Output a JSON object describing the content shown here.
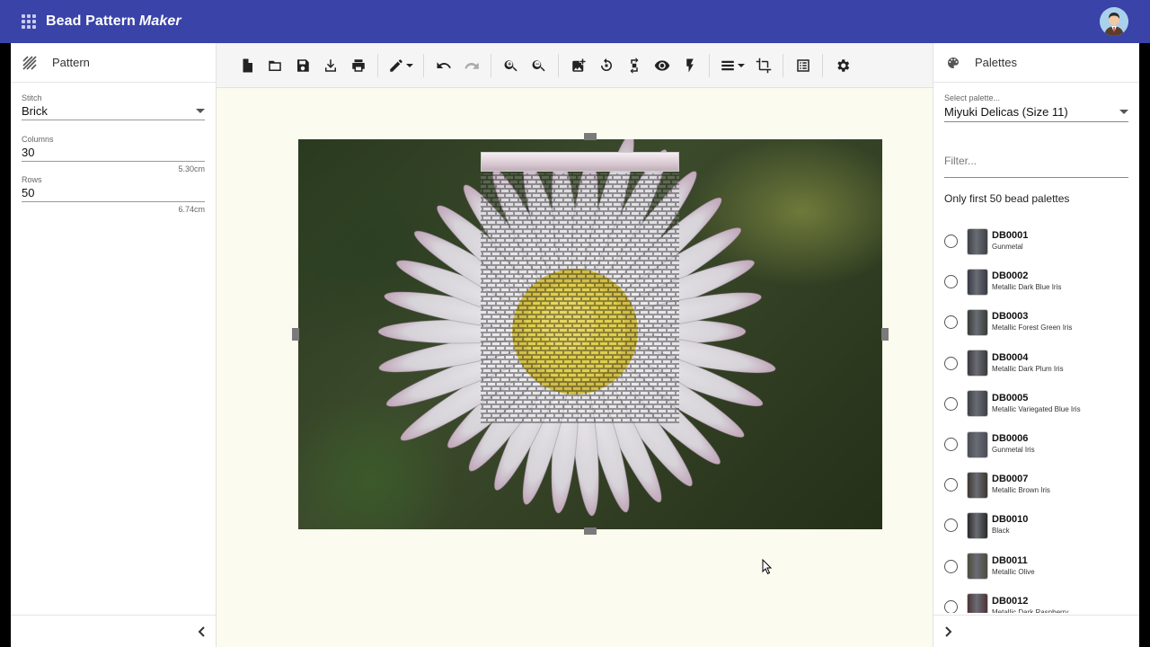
{
  "app": {
    "title": "Bead Pattern",
    "title_emphasis": "Maker",
    "bar_color": "#3a43a8"
  },
  "left_panel": {
    "header": "Pattern",
    "stitch": {
      "label": "Stitch",
      "value": "Brick"
    },
    "columns": {
      "label": "Columns",
      "value": "30",
      "hint": "5.30cm"
    },
    "rows": {
      "label": "Rows",
      "value": "50",
      "hint": "6.74cm"
    },
    "collapse_icon": "chevron-left-icon"
  },
  "toolbar": {
    "icons": [
      "new-file-icon",
      "open-folder-icon",
      "save-icon",
      "download-icon",
      "print-icon",
      "pen-icon",
      "undo-icon",
      "redo-icon",
      "zoom-in-icon",
      "zoom-out-icon",
      "add-image-icon",
      "rotate-icon",
      "flip-icon",
      "eye-icon",
      "flash-icon",
      "rows-icon",
      "crop-icon",
      "list-icon",
      "gear-icon"
    ],
    "redo_disabled": true
  },
  "canvas": {
    "background": "#fbfcef"
  },
  "right_panel": {
    "header": "Palettes",
    "select_label": "Select palette...",
    "select_value": "Miyuki Delicas (Size 11)",
    "filter_placeholder": "Filter...",
    "note": "Only first 50 bead palettes",
    "beads": [
      {
        "code": "DB0001",
        "name": "Gunmetal",
        "color": "#3f4147"
      },
      {
        "code": "DB0002",
        "name": "Metallic Dark Blue Iris",
        "color": "#373a45"
      },
      {
        "code": "DB0003",
        "name": "Metallic Forest Green Iris",
        "color": "#383c38"
      },
      {
        "code": "DB0004",
        "name": "Metallic Dark Plum Iris",
        "color": "#3a393d"
      },
      {
        "code": "DB0005",
        "name": "Metallic Variegated Blue Iris",
        "color": "#3e4048"
      },
      {
        "code": "DB0006",
        "name": "Gunmetal Iris",
        "color": "#4a4d55"
      },
      {
        "code": "DB0007",
        "name": "Metallic Brown Iris",
        "color": "#3c3730"
      },
      {
        "code": "DB0010",
        "name": "Black",
        "color": "#2a2a2a"
      },
      {
        "code": "DB0011",
        "name": "Metallic Olive",
        "color": "#4b4c3c"
      },
      {
        "code": "DB0012",
        "name": "Metallic Dark Raspberry",
        "color": "#4d3338"
      }
    ],
    "expand_icon": "chevron-right-icon"
  }
}
